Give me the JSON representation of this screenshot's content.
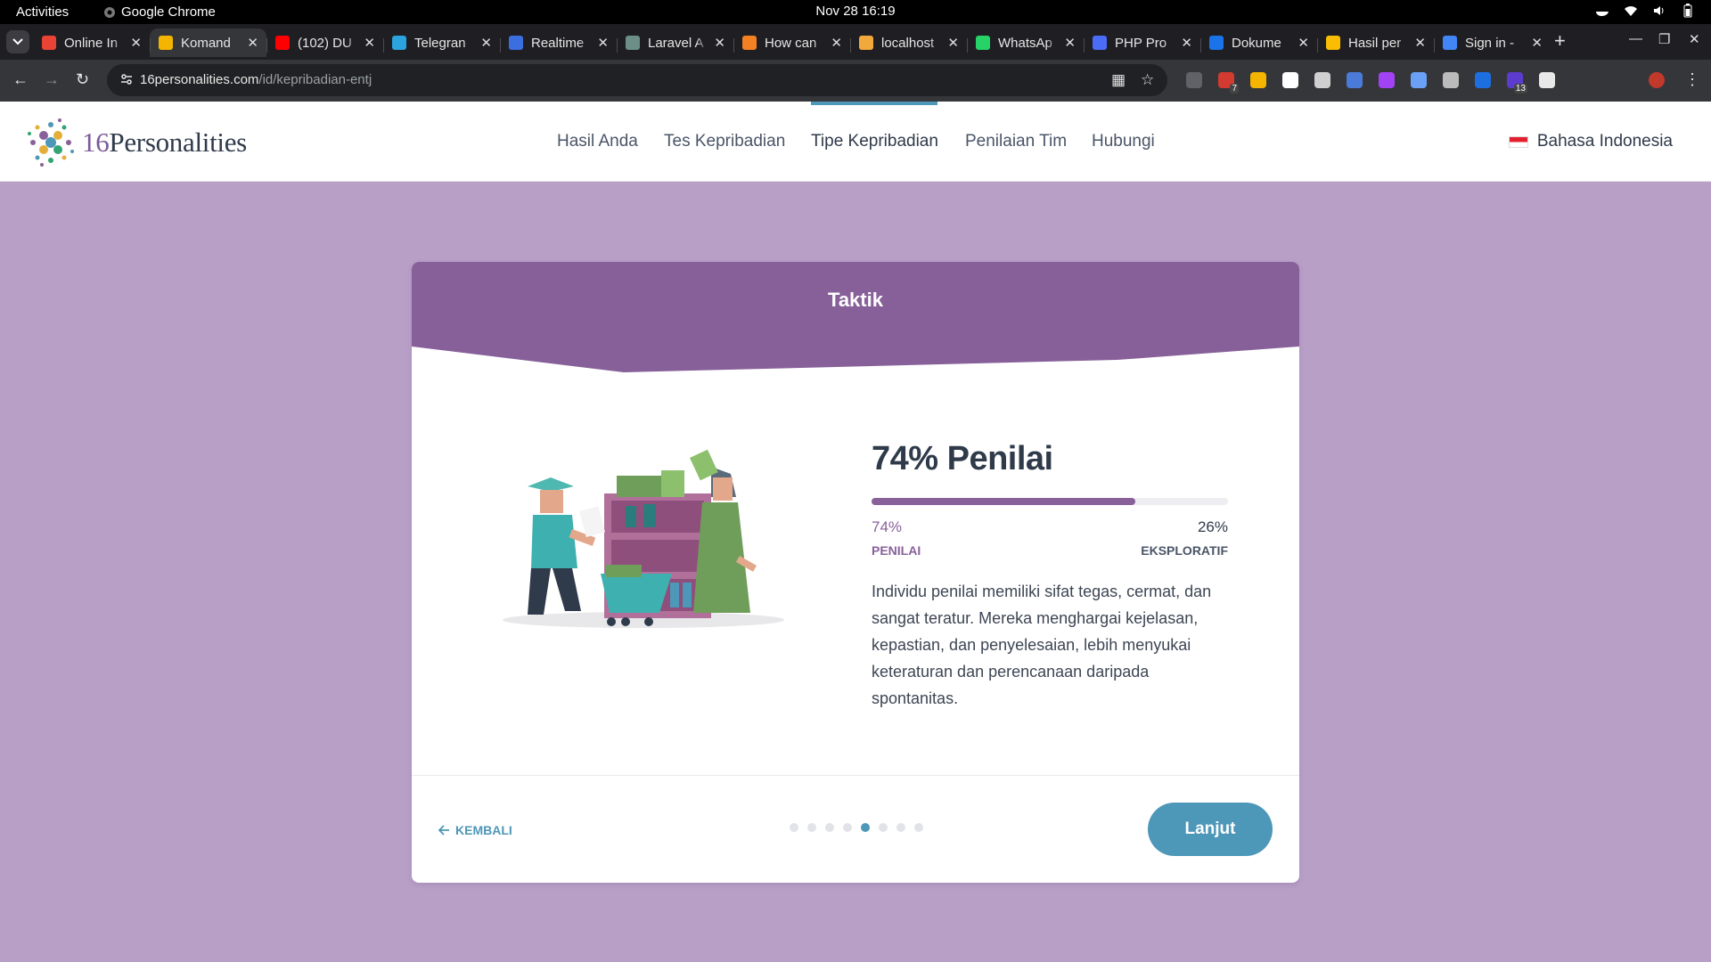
{
  "system": {
    "activities": "Activities",
    "app_name": "Google Chrome",
    "clock": "Nov 28  16:19"
  },
  "tabs": [
    {
      "title": "Online In",
      "color": "#ea4335"
    },
    {
      "title": "Komand",
      "color": "#f5b400",
      "active": true
    },
    {
      "title": "(102) DU",
      "color": "#ff0000"
    },
    {
      "title": "Telegran",
      "color": "#2aa3df"
    },
    {
      "title": "Realtime",
      "color": "#3b6fe0"
    },
    {
      "title": "Laravel A",
      "color": "#6b8f86"
    },
    {
      "title": "How can",
      "color": "#f48024"
    },
    {
      "title": "localhost",
      "color": "#f2a93b"
    },
    {
      "title": "WhatsAp",
      "color": "#25d366"
    },
    {
      "title": "PHP Pro",
      "color": "#4a6cf7"
    },
    {
      "title": "Dokume",
      "color": "#1a73e8"
    },
    {
      "title": "Hasil per",
      "color": "#fbbc04"
    },
    {
      "title": "Sign in -",
      "color": "#4285f4"
    }
  ],
  "address": {
    "domain": "16personalities.com",
    "path": "/id/kepribadian-entj"
  },
  "extensions": [
    {
      "color": "#5f6368"
    },
    {
      "color": "#d33b30",
      "badge": "7"
    },
    {
      "color": "#f5b400"
    },
    {
      "color": "#ffffff"
    },
    {
      "color": "#d0d0d0"
    },
    {
      "color": "#4a7bd8"
    },
    {
      "color": "#a142f4"
    },
    {
      "color": "#6aa0f5"
    },
    {
      "color": "#bbbbbb"
    },
    {
      "color": "#1d6fe0"
    },
    {
      "color": "#5b3ccf",
      "badge": "13"
    },
    {
      "color": "#e8e8e8"
    }
  ],
  "site": {
    "logo_number": "16",
    "logo_word": "Personalities",
    "nav": [
      {
        "label": "Hasil Anda"
      },
      {
        "label": "Tes Kepribadian"
      },
      {
        "label": "Tipe Kepribadian",
        "active": true
      },
      {
        "label": "Penilaian Tim"
      },
      {
        "label": "Hubungi"
      }
    ],
    "language": "Bahasa Indonesia"
  },
  "card": {
    "header": "Taktik",
    "header_color": "#87609a",
    "trait_title": "74% Penilai",
    "progress_fraction": 0.74,
    "left_percent": "74%",
    "left_label": "PENILAI",
    "right_percent": "26%",
    "right_label": "EKSPLORATIF",
    "description": "Individu penilai memiliki sifat tegas, cermat, dan sangat teratur. Mereka menghargai kejelasan, kepastian, dan penyelesaian, lebih menyukai keteraturan dan perencanaan daripada spontanitas.",
    "back_label": "KEMBALI",
    "next_label": "Lanjut",
    "pagination": {
      "total": 8,
      "current": 5
    }
  }
}
